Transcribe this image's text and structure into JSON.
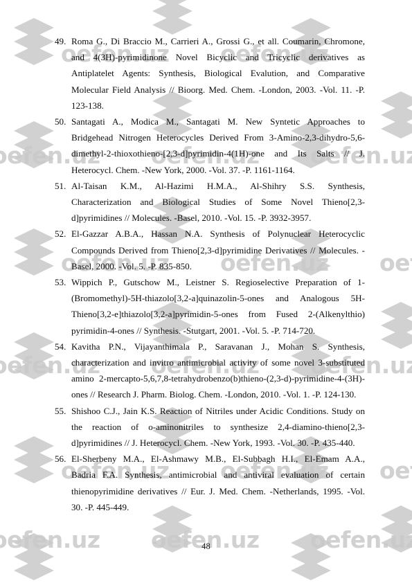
{
  "document": {
    "type": "bibliography-references-page",
    "page_number": "48",
    "watermark": {
      "text": "oefen.uz",
      "logo_icon": "stacked-diamond-logo-icon",
      "color": "#c9c9c9"
    }
  },
  "references": [
    {
      "number": "49.",
      "lines": [
        "Roma G., Di Braccio M., Carrieri A., Grossi G., et all. Coumarin, Chromone,",
        "and 4(3H)-pyrimidinone Novel Bicyclic and Tricyclic derivatives as",
        "Antiplatelet Agents: Synthesis, Biological Evalution, and Comparative",
        "Molecular Field Analysis // Bioorg. Med. Chem. -London, 2003. -Vol. 11. -P.",
        "123-138."
      ],
      "text": "Roma G., Di Braccio M., Carrieri A., Grossi G., et all. Coumarin, Chromone, and 4(3H)-pyrimidinone Novel Bicyclic and Tricyclic derivatives as Antiplatelet Agents: Synthesis, Biological Evalution, and Comparative Molecular Field Analysis // Bioorg. Med. Chem. -London, 2003. -Vol. 11. -P. 123-138."
    },
    {
      "number": "50.",
      "lines": [
        "Santagati A., Modica M., Santagati M. New Syntetic Approaches to",
        "Bridgehead Nitrogen Heterocycles Derived From 3-Amino-2,3-dihydro-5,6-",
        "dimethyl-2-thioxothieno-[2,3-d]pyrimidin-4(1H)-one and Its Salts // J.",
        "Heterocycl. Chem. -New York, 2000. -Vol. 37. -P. 1161-1164."
      ],
      "text": "Santagati A., Modica M., Santagati M. New Syntetic Approaches to Bridgehead Nitrogen Heterocycles Derived From 3-Amino-2,3-dihydro-5,6-dimethyl-2-thioxothieno-[2,3-d]pyrimidin-4(1H)-one and Its Salts // J. Heterocycl. Chem. -New York, 2000. -Vol. 37. -P. 1161-1164."
    },
    {
      "number": "51.",
      "lines": [
        "Al-Taisan K.M., Al-Hazimi H.M.A., Al-Shihry S.S. Synthesis,",
        "Characterization and Biological Studies of Some Novel Thieno[2,3-",
        "d]pyrimidines // Molecules. -Basel, 2010. -Vol. 15. -P. 3932-3957."
      ],
      "text": "Al-Taisan K.M., Al-Hazimi H.M.A., Al-Shihry S.S. Synthesis, Characterization and Biological Studies of Some Novel Thieno[2,3-d]pyrimidines // Molecules. -Basel, 2010. -Vol. 15. -P. 3932-3957."
    },
    {
      "number": "52.",
      "lines": [
        "El-Gazzar A.B.A., Hassan N.A. Synthesis of Polynuclear Heterocyclic",
        "Compounds Derived from Thieno[2,3-d]pyrimidine Derivatives // Molecules. -",
        "Basel, 2000. -Vol. 5. -P. 835-850."
      ],
      "text": "El-Gazzar A.B.A., Hassan N.A. Synthesis of Polynuclear Heterocyclic Compounds Derived from Thieno[2,3-d]pyrimidine Derivatives // Molecules. -Basel, 2000. -Vol. 5. -P. 835-850."
    },
    {
      "number": "53.",
      "lines": [
        "Wippich P., Gutschow M., Leistner S. Regioselective Preparation of 1-",
        "(Bromomethyl)-5H-thiazolo[3,2-a]quinazolin-5-ones and Analogous 5H-",
        "Thieno[3,2-e]thiazolo[3,2-a]pyrimidin-5-ones from Fused 2-(Alkenylthio)",
        "pyrimidin-4-ones // Synthesis. -Stutgart, 2001. -Vol. 5. -P. 714-720."
      ],
      "text": "Wippich P., Gutschow M., Leistner S. Regioselective Preparation of 1-(Bromomethyl)-5H-thiazolo[3,2-a]quinazolin-5-ones and Analogous 5H-Thieno[3,2-e]thiazolo[3,2-a]pyrimidin-5-ones from Fused 2-(Alkenylthio) pyrimidin-4-ones // Synthesis. -Stutgart, 2001. -Vol. 5. -P. 714-720."
    },
    {
      "number": "54.",
      "lines": [
        "Kavitha P.N., Vijayanthimala P., Saravanan J., Mohan S. Synthesis,",
        "characterization and invitro antimicrobial activity of some novel 3-substituted",
        "amino 2-mercapto-5,6,7,8-tetrahydrobenzo(b)thieno-(2,3-d)-pyrimidine-4-(3H)-",
        "ones // Research J. Pharm. Biolog. Chem. -London, 2010. -Vol. 1. -P. 124-130."
      ],
      "text": "Kavitha P.N., Vijayanthimala P., Saravanan J., Mohan S. Synthesis, characterization and invitro antimicrobial activity of some novel 3-substituted amino 2-mercapto-5,6,7,8-tetrahydrobenzo(b)thieno-(2,3-d)-pyrimidine-4-(3H)-ones // Research J. Pharm. Biolog. Chem. -London, 2010. -Vol. 1. -P. 124-130."
    },
    {
      "number": "55.",
      "lines": [
        "Shishoo C.J., Jain K.S. Reaction of Nitriles under Acidic Conditions. Study on",
        "the reaction of o-aminonitriles to synthesize 2,4-diamino-thieno[2,3-",
        "d]pyrimidines // J. Heterocycl. Chem. -New York, 1993. -Vol. 30. -P. 435-440."
      ],
      "text": "Shishoo C.J., Jain K.S. Reaction of Nitriles under Acidic Conditions. Study on the reaction of o-aminonitriles to synthesize 2,4-diamino-thieno[2,3-d]pyrimidines // J. Heterocycl. Chem. -New York, 1993. -Vol. 30. -P. 435-440."
    },
    {
      "number": "56.",
      "lines": [
        "El-Sherbeny M.A., El-Ashmawy M.B., El-Subbagh H.I., El-Emam A.A.,",
        "Badria F.A. Synthesis, antimicrobial and antiviral evaluation of certain",
        "thienopyrimidine derivatives // Eur. J. Med. Chem. -Netherlands, 1995. -Vol.",
        "30. -P. 445-449."
      ],
      "text": "El-Sherbeny M.A., El-Ashmawy M.B., El-Subbagh H.I., El-Emam A.A., Badria F.A. Synthesis, antimicrobial and antiviral evaluation of certain thienopyrimidine derivatives // Eur. J. Med. Chem. -Netherlands, 1995. -Vol. 30. -P. 445-449."
    }
  ]
}
